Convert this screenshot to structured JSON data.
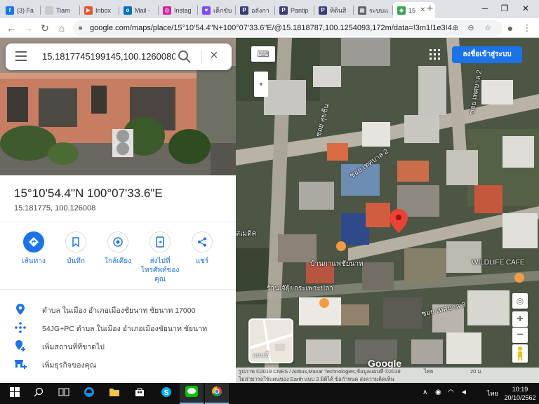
{
  "browser": {
    "tabs": [
      {
        "label": "(3) Fa",
        "icon": "facebook-icon",
        "color": "#1877f2",
        "glyph": "f"
      },
      {
        "label": "Tiam",
        "icon": "page-icon",
        "color": "#c9c9c9",
        "glyph": ""
      },
      {
        "label": "Inbox",
        "icon": "inbox-icon",
        "color": "#e8542a",
        "glyph": "▶"
      },
      {
        "label": "Mail -",
        "icon": "outlook-icon",
        "color": "#0072c6",
        "glyph": "o"
      },
      {
        "label": "Instag",
        "icon": "instagram-icon",
        "color": "#d6249f",
        "glyph": "◎"
      },
      {
        "label": "เด็กขับ",
        "icon": "heart-icon",
        "color": "#7c4dff",
        "glyph": "♥"
      },
      {
        "label": "อลังกา",
        "icon": "pantip-icon",
        "color": "#3b3f75",
        "glyph": "P"
      },
      {
        "label": "Pantip",
        "icon": "pantip-icon",
        "color": "#3b3f75",
        "glyph": "P"
      },
      {
        "label": "ทิดินสิ",
        "icon": "pantip-icon",
        "color": "#3b3f75",
        "glyph": "P"
      },
      {
        "label": "ระบบเเ",
        "icon": "doc-icon",
        "color": "#5f6368",
        "glyph": "▦"
      },
      {
        "label": "15",
        "icon": "google-maps-icon",
        "color": "#34a853",
        "glyph": "◆",
        "active": true
      }
    ],
    "new_tab": "+",
    "window": {
      "minimize": "─",
      "maximize": "❐",
      "close": "✕"
    },
    "url": "google.com/maps/place/15°10'54.4\"N+100°07'33.6\"E/@15.1818787,100.1254093,172m/data=!3m1!1e3!4..."
  },
  "search": {
    "query": "15.1817745199145,100.1260080"
  },
  "place": {
    "title": "15°10'54.4\"N 100°07'33.6\"E",
    "subtitle": "15.181775, 100.126008",
    "actions": [
      {
        "label": "เส้นทาง",
        "icon": "directions-icon"
      },
      {
        "label": "บันทึก",
        "icon": "bookmark-icon"
      },
      {
        "label": "ใกล้เคียง",
        "icon": "nearby-icon"
      },
      {
        "label": "ส่งไปที่โทรศัพท์ของคุณ",
        "icon": "send-to-phone-icon"
      },
      {
        "label": "แชร์",
        "icon": "share-icon"
      }
    ],
    "info": [
      {
        "text": "ตำบล ในเมือง อำเภอเมืองชัยนาท ชัยนาท 17000",
        "icon": "location-pin-icon"
      },
      {
        "text": "54JG+PC ตำบล ในเมือง อำเภอเมืองชัยนาท ชัยนาท",
        "icon": "plus-code-icon"
      },
      {
        "text": "เพิ่มสถานที่ที่ขาดไป",
        "icon": "add-place-icon"
      },
      {
        "text": "เพิ่มธุรกิจของคุณ",
        "icon": "add-business-icon"
      }
    ]
  },
  "map": {
    "signin_label": "ลงชื่อเข้าสู่ระบบ",
    "labels": [
      {
        "text": "ซอย เทศบาล 2",
        "name": "road-label-thetsaban-2-upper"
      },
      {
        "text": "ซอย สุขชีน",
        "name": "road-label-sukchin"
      },
      {
        "text": "ซอย เทศบาล 2",
        "name": "road-label-thetsaban-2-lower"
      },
      {
        "text": "สเมดิค",
        "name": "poi-label-smedic"
      },
      {
        "text": "บ้านกาแฟชัยนาท",
        "name": "poi-label-coffee"
      },
      {
        "text": "WILDLIFE CAFE",
        "name": "poi-label-wildlife-cafe"
      },
      {
        "text": "ร้านเจ๊ยุ้ยกระเพาะปลา",
        "name": "poi-label-restaurant"
      },
      {
        "text": "ซอย เทศบาล 3",
        "name": "road-label-thetsaban-3"
      }
    ],
    "minimap_label": "แผนที่",
    "google": "Google",
    "attribution": "รูปภาพ ©2019 CNES / Airbus,Maxar Technologies,ข้อมูลแผนที่ ©2019",
    "attribution_line2": "ไม่สามารถใช้แผนของ Earth แบบ 3 มิติได้     ข้อกำหนด     ส่งความคิดเห็น",
    "thai_label": "ไทย",
    "scale": "20 ม."
  },
  "taskbar": {
    "apps": [
      {
        "name": "start-button",
        "icon": "windows-logo-icon"
      },
      {
        "name": "search-button",
        "icon": "search-icon"
      },
      {
        "name": "task-view-button",
        "icon": "task-view-icon"
      },
      {
        "name": "edge-app",
        "icon": "edge-icon"
      },
      {
        "name": "explorer-app",
        "icon": "folder-icon"
      },
      {
        "name": "store-app",
        "icon": "store-icon"
      },
      {
        "name": "skype-app",
        "icon": "skype-icon"
      },
      {
        "name": "line-app",
        "icon": "line-icon"
      },
      {
        "name": "chrome-app",
        "icon": "chrome-icon"
      }
    ],
    "tray_lang": "ไทย",
    "time": "10:19",
    "date": "20/10/2562"
  },
  "colors": {
    "accent": "#1a73e8",
    "pin": "#ea4335",
    "signin": "#1a73e8"
  }
}
